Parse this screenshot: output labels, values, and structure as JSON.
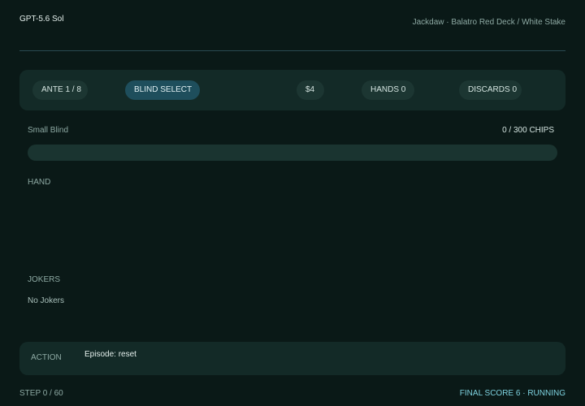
{
  "header": {
    "model": "GPT-5.6 Sol",
    "subtitle": "Jackdaw · Balatro Red Deck / White Stake"
  },
  "status": {
    "ante": "ANTE 1 / 8",
    "phase": "BLIND SELECT",
    "money": "$4",
    "hands": "HANDS 0",
    "discards": "DISCARDS 0"
  },
  "blind": {
    "name": "Small Blind",
    "chips_readout": "0 / 300 CHIPS",
    "chips_current": 0,
    "chips_target": 300
  },
  "hand": {
    "label": "HAND",
    "cards": []
  },
  "jokers": {
    "label": "JOKERS",
    "empty_text": "No Jokers"
  },
  "action": {
    "label": "ACTION",
    "text": "Episode: reset"
  },
  "footer": {
    "step": "STEP 0 / 60",
    "status": "FINAL SCORE 6 · RUNNING"
  },
  "colors": {
    "background": "#0a1917",
    "panel": "#132a27",
    "accent_phase": "#1e4e5c",
    "status_text": "#7ed3e0"
  }
}
